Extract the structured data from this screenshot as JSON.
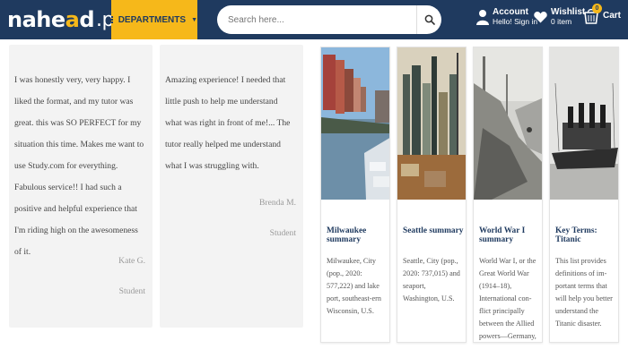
{
  "header": {
    "logo_main": "nahe",
    "logo_accent": "a",
    "logo_rest": "d",
    "logo_suffix": ".pk",
    "departments_label": "DEPARTMENTS",
    "search_placeholder": "Search here...",
    "account_title": "Account",
    "account_subtitle": "Hello! Sign in",
    "wishlist_title": "Wishlist",
    "wishlist_subtitle": "0 item",
    "cart_label": "Cart",
    "cart_count": "0"
  },
  "reviews": [
    {
      "text": "I was honestly very, very happy. I liked the format, and my tutor was great. this was SO PERFECT for my situation this time. Makes me want to use Study.com for everything. Fabulous service!! I had such a positive and helpful experience that I'm riding high on the awesomeness of it.",
      "name": "Kate G.",
      "role": "Student"
    },
    {
      "text": "Amazing experience! I needed that little push to help me understand what was right in front of me!... The tutor really helped me understand what I was struggling with.",
      "name": "Brenda M.",
      "role": "Student"
    }
  ],
  "cards": [
    {
      "title": "Milwaukee summary",
      "description": "Milwaukee, City (pop., 2020: 577,222) and lake port, southeast-ern Wisconsin, U.S."
    },
    {
      "title": "Seattle summary",
      "description": "Seattle, City (pop., 2020: 737,015) and seaport, Washington, U.S."
    },
    {
      "title": "World War I summary",
      "description": "World War I, or the Great World War (1914–18), International con-flict principally between the Allied powers—Germany, Italy..."
    },
    {
      "title": "Key Terms: Titanic",
      "description": "This list provides definitions of im-portant terms that will help you better understand the Titanic disaster."
    }
  ]
}
